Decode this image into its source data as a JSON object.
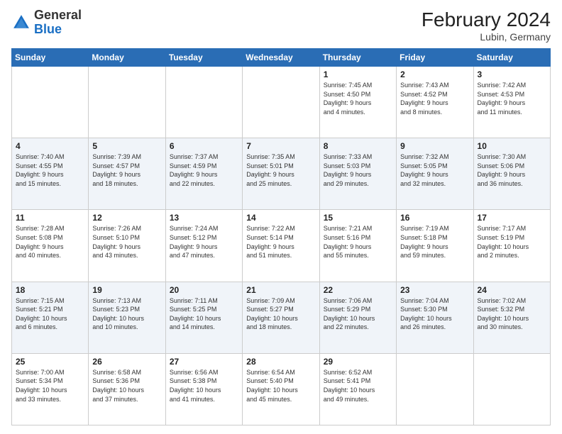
{
  "header": {
    "logo_general": "General",
    "logo_blue": "Blue",
    "title": "February 2024",
    "location": "Lubin, Germany"
  },
  "days_of_week": [
    "Sunday",
    "Monday",
    "Tuesday",
    "Wednesday",
    "Thursday",
    "Friday",
    "Saturday"
  ],
  "weeks": [
    [
      {
        "day": "",
        "info": ""
      },
      {
        "day": "",
        "info": ""
      },
      {
        "day": "",
        "info": ""
      },
      {
        "day": "",
        "info": ""
      },
      {
        "day": "1",
        "info": "Sunrise: 7:45 AM\nSunset: 4:50 PM\nDaylight: 9 hours\nand 4 minutes."
      },
      {
        "day": "2",
        "info": "Sunrise: 7:43 AM\nSunset: 4:52 PM\nDaylight: 9 hours\nand 8 minutes."
      },
      {
        "day": "3",
        "info": "Sunrise: 7:42 AM\nSunset: 4:53 PM\nDaylight: 9 hours\nand 11 minutes."
      }
    ],
    [
      {
        "day": "4",
        "info": "Sunrise: 7:40 AM\nSunset: 4:55 PM\nDaylight: 9 hours\nand 15 minutes."
      },
      {
        "day": "5",
        "info": "Sunrise: 7:39 AM\nSunset: 4:57 PM\nDaylight: 9 hours\nand 18 minutes."
      },
      {
        "day": "6",
        "info": "Sunrise: 7:37 AM\nSunset: 4:59 PM\nDaylight: 9 hours\nand 22 minutes."
      },
      {
        "day": "7",
        "info": "Sunrise: 7:35 AM\nSunset: 5:01 PM\nDaylight: 9 hours\nand 25 minutes."
      },
      {
        "day": "8",
        "info": "Sunrise: 7:33 AM\nSunset: 5:03 PM\nDaylight: 9 hours\nand 29 minutes."
      },
      {
        "day": "9",
        "info": "Sunrise: 7:32 AM\nSunset: 5:05 PM\nDaylight: 9 hours\nand 32 minutes."
      },
      {
        "day": "10",
        "info": "Sunrise: 7:30 AM\nSunset: 5:06 PM\nDaylight: 9 hours\nand 36 minutes."
      }
    ],
    [
      {
        "day": "11",
        "info": "Sunrise: 7:28 AM\nSunset: 5:08 PM\nDaylight: 9 hours\nand 40 minutes."
      },
      {
        "day": "12",
        "info": "Sunrise: 7:26 AM\nSunset: 5:10 PM\nDaylight: 9 hours\nand 43 minutes."
      },
      {
        "day": "13",
        "info": "Sunrise: 7:24 AM\nSunset: 5:12 PM\nDaylight: 9 hours\nand 47 minutes."
      },
      {
        "day": "14",
        "info": "Sunrise: 7:22 AM\nSunset: 5:14 PM\nDaylight: 9 hours\nand 51 minutes."
      },
      {
        "day": "15",
        "info": "Sunrise: 7:21 AM\nSunset: 5:16 PM\nDaylight: 9 hours\nand 55 minutes."
      },
      {
        "day": "16",
        "info": "Sunrise: 7:19 AM\nSunset: 5:18 PM\nDaylight: 9 hours\nand 59 minutes."
      },
      {
        "day": "17",
        "info": "Sunrise: 7:17 AM\nSunset: 5:19 PM\nDaylight: 10 hours\nand 2 minutes."
      }
    ],
    [
      {
        "day": "18",
        "info": "Sunrise: 7:15 AM\nSunset: 5:21 PM\nDaylight: 10 hours\nand 6 minutes."
      },
      {
        "day": "19",
        "info": "Sunrise: 7:13 AM\nSunset: 5:23 PM\nDaylight: 10 hours\nand 10 minutes."
      },
      {
        "day": "20",
        "info": "Sunrise: 7:11 AM\nSunset: 5:25 PM\nDaylight: 10 hours\nand 14 minutes."
      },
      {
        "day": "21",
        "info": "Sunrise: 7:09 AM\nSunset: 5:27 PM\nDaylight: 10 hours\nand 18 minutes."
      },
      {
        "day": "22",
        "info": "Sunrise: 7:06 AM\nSunset: 5:29 PM\nDaylight: 10 hours\nand 22 minutes."
      },
      {
        "day": "23",
        "info": "Sunrise: 7:04 AM\nSunset: 5:30 PM\nDaylight: 10 hours\nand 26 minutes."
      },
      {
        "day": "24",
        "info": "Sunrise: 7:02 AM\nSunset: 5:32 PM\nDaylight: 10 hours\nand 30 minutes."
      }
    ],
    [
      {
        "day": "25",
        "info": "Sunrise: 7:00 AM\nSunset: 5:34 PM\nDaylight: 10 hours\nand 33 minutes."
      },
      {
        "day": "26",
        "info": "Sunrise: 6:58 AM\nSunset: 5:36 PM\nDaylight: 10 hours\nand 37 minutes."
      },
      {
        "day": "27",
        "info": "Sunrise: 6:56 AM\nSunset: 5:38 PM\nDaylight: 10 hours\nand 41 minutes."
      },
      {
        "day": "28",
        "info": "Sunrise: 6:54 AM\nSunset: 5:40 PM\nDaylight: 10 hours\nand 45 minutes."
      },
      {
        "day": "29",
        "info": "Sunrise: 6:52 AM\nSunset: 5:41 PM\nDaylight: 10 hours\nand 49 minutes."
      },
      {
        "day": "",
        "info": ""
      },
      {
        "day": "",
        "info": ""
      }
    ]
  ]
}
